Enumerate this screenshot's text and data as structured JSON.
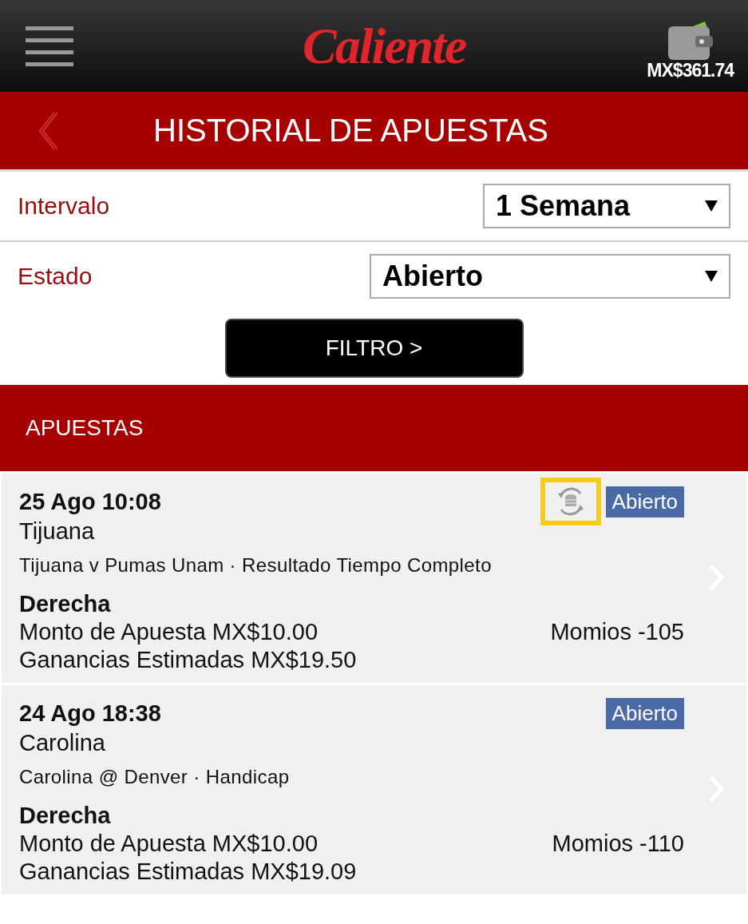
{
  "header": {
    "logo": "Caliente",
    "balance": "MX$361.74"
  },
  "title": "HISTORIAL DE APUESTAS",
  "filters": [
    {
      "label": "Intervalo",
      "value": "1 Semana",
      "wide": false
    },
    {
      "label": "Estado",
      "value": "Abierto",
      "wide": true
    }
  ],
  "filter_button": "FILTRO >",
  "section_title": "APUESTAS",
  "bets": [
    {
      "date": "25 Ago 10:08",
      "team": "Tijuana",
      "event": "Tijuana v Pumas Unam · Resultado Tiempo Completo",
      "status": "Abierto",
      "cashout": true,
      "selection": "Derecha",
      "stake": "Monto de Apuesta MX$10.00",
      "odds": "Momios -105",
      "winnings": "Ganancias Estimadas MX$19.50"
    },
    {
      "date": "24 Ago 18:38",
      "team": "Carolina",
      "event": "Carolina @ Denver · Handicap",
      "status": "Abierto",
      "cashout": false,
      "selection": "Derecha",
      "stake": "Monto de Apuesta MX$10.00",
      "odds": "Momios -110",
      "winnings": "Ganancias Estimadas MX$19.09"
    }
  ]
}
